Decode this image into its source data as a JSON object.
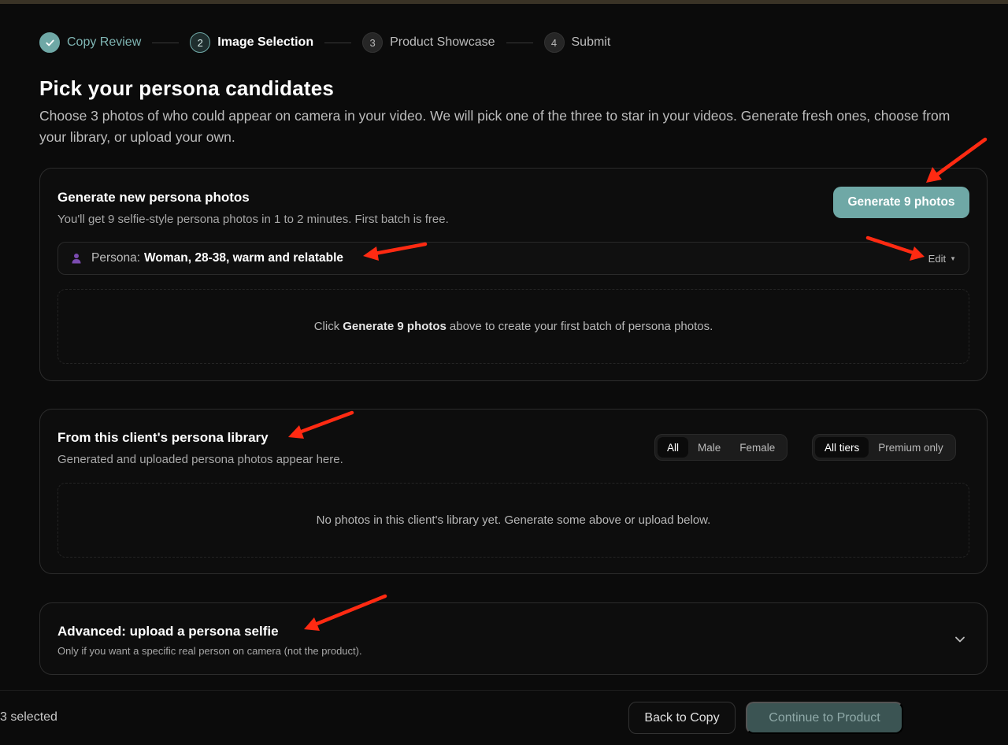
{
  "stepper": {
    "steps": [
      {
        "num": "✓",
        "label": "Copy Review",
        "state": "done"
      },
      {
        "num": "2",
        "label": "Image Selection",
        "state": "active"
      },
      {
        "num": "3",
        "label": "Product Showcase",
        "state": "pending"
      },
      {
        "num": "4",
        "label": "Submit",
        "state": "pending"
      }
    ]
  },
  "header": {
    "title": "Pick your persona candidates",
    "subtitle": "Choose 3 photos of who could appear on camera in your video. We will pick one of the three to star in your videos. Generate fresh ones, choose from your library, or upload your own."
  },
  "generate": {
    "title": "Generate new persona photos",
    "subtitle": "You'll get 9 selfie-style persona photos in 1 to 2 minutes. First batch is free.",
    "button_label": "Generate 9 photos",
    "persona_key": "Persona:",
    "persona_value": "Woman, 28-38, warm and relatable",
    "edit_label": "Edit",
    "empty_pre": "Click",
    "empty_bold": "Generate 9 photos",
    "empty_post": "above to create your first batch of persona photos."
  },
  "library": {
    "title": "From this client's persona library",
    "subtitle": "Generated and uploaded persona photos appear here.",
    "gender_filters": [
      "All",
      "Male",
      "Female"
    ],
    "tier_filters": [
      "All tiers",
      "Premium only"
    ],
    "empty_text": "No photos in this client's library yet. Generate some above or upload below."
  },
  "advanced": {
    "title": "Advanced: upload a persona selfie",
    "subtitle": "Only if you want a specific real person on camera (not the product)."
  },
  "footer": {
    "selected_text": "3 selected",
    "back_label": "Back to Copy",
    "continue_label": "Continue to Product"
  },
  "colors": {
    "accent": "#6fa8a6",
    "annotation_arrow": "#ff2a12"
  }
}
